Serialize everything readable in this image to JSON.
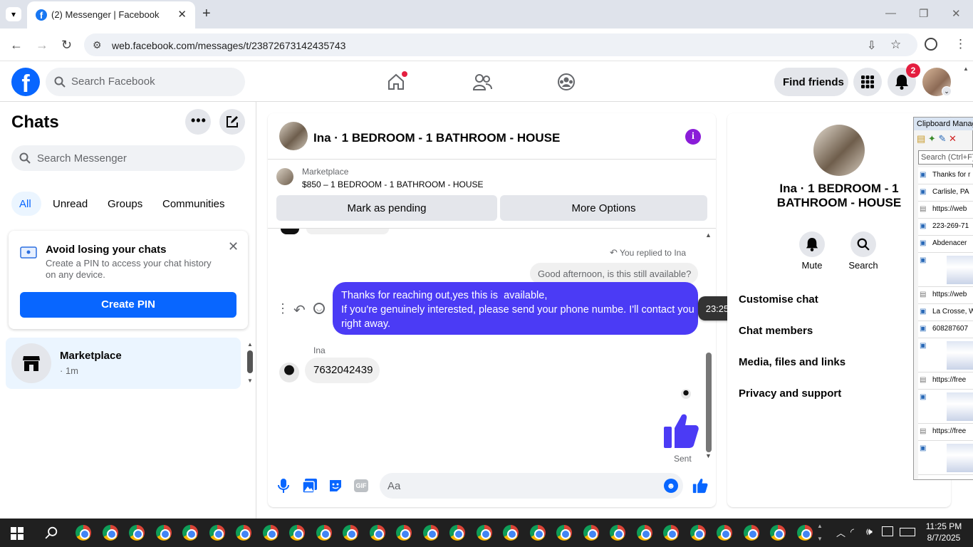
{
  "browser": {
    "tab_title": "(2) Messenger | Facebook",
    "tab_favicon": "f",
    "url": "web.facebook.com/messages/t/23872673142435743"
  },
  "header": {
    "logo": "f",
    "search_placeholder": "Search Facebook",
    "find_friends": "Find friends",
    "notif_count": "2"
  },
  "left": {
    "title": "Chats",
    "search_placeholder": "Search Messenger",
    "filters": [
      "All",
      "Unread",
      "Groups",
      "Communities"
    ],
    "banner": {
      "title": "Avoid losing your chats",
      "text": "Create a PIN to access your chat history on any device.",
      "button": "Create PIN"
    },
    "chats": [
      {
        "name": "Marketplace",
        "meta": "· 1m"
      }
    ]
  },
  "conversation": {
    "title": "Ina · 1 BEDROOM - 1 BATHROOM - HOUSE",
    "listing_source": "Marketplace",
    "listing_title": "$850 – 1 BEDROOM - 1 BATHROOM - HOUSE",
    "mark_pending": "Mark as pending",
    "more_options": "More Options",
    "replied_to": "You replied to Ina",
    "quoted": "Good afternoon, is this still available?",
    "sent_message": "Thanks for reaching out,yes this is  available,\nIf you're genuinely interested, please send your phone numbe. I'll contact you right away.",
    "timestamp": "23:25",
    "sender_name": "Ina",
    "received_message": "7632042439",
    "status": "Sent",
    "composer_placeholder": "Aa"
  },
  "info_panel": {
    "name": "Ina · 1 BEDROOM - 1 BATHROOM - HOUSE",
    "mute": "Mute",
    "search": "Search",
    "items": [
      "Customise chat",
      "Chat members",
      "Media, files and links",
      "Privacy and support"
    ]
  },
  "clipboard": {
    "title": "Clipboard Manager",
    "search_placeholder": "Search (Ctrl+F)",
    "entries": [
      "Thanks for r",
      "Carlisle, PA",
      "https://web",
      "223-269-71",
      "Abdenacer",
      "https://web",
      "La Crosse, W",
      "608287607",
      "https://free",
      "https://free"
    ]
  },
  "taskbar": {
    "time": "11:25 PM",
    "date": "8/7/2025"
  },
  "colors": {
    "fb_blue": "#0866ff",
    "sent_bubble": "#4b3bf5",
    "text_primary": "#050505"
  }
}
